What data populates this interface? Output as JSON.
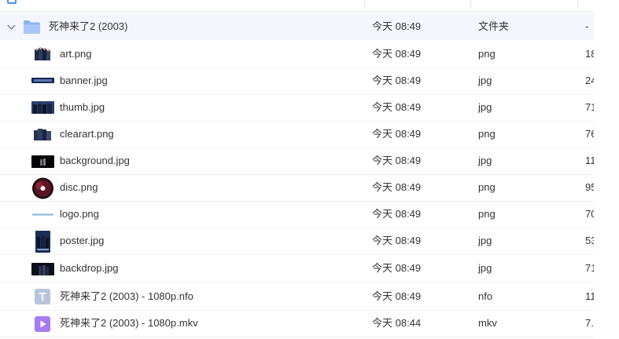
{
  "folder": {
    "name": "死神来了2 (2003)",
    "date": "今天 08:49",
    "type": "文件夹",
    "size": "-"
  },
  "files": [
    {
      "name": "art.png",
      "date": "今天 08:49",
      "type": "png",
      "size": "18",
      "icon": "art-thumbnail-icon"
    },
    {
      "name": "banner.jpg",
      "date": "今天 08:49",
      "type": "jpg",
      "size": "24",
      "icon": "banner-thumbnail-icon"
    },
    {
      "name": "thumb.jpg",
      "date": "今天 08:49",
      "type": "jpg",
      "size": "71",
      "icon": "thumb-thumbnail-icon"
    },
    {
      "name": "clearart.png",
      "date": "今天 08:49",
      "type": "png",
      "size": "76",
      "icon": "clearart-thumbnail-icon"
    },
    {
      "name": "background.jpg",
      "date": "今天 08:49",
      "type": "jpg",
      "size": "11",
      "icon": "background-thumbnail-icon"
    },
    {
      "name": "disc.png",
      "date": "今天 08:49",
      "type": "png",
      "size": "95",
      "icon": "disc-thumbnail-icon"
    },
    {
      "name": "logo.png",
      "date": "今天 08:49",
      "type": "png",
      "size": "70",
      "icon": "logo-thumbnail-icon"
    },
    {
      "name": "poster.jpg",
      "date": "今天 08:49",
      "type": "jpg",
      "size": "53",
      "icon": "poster-thumbnail-icon"
    },
    {
      "name": "backdrop.jpg",
      "date": "今天 08:49",
      "type": "jpg",
      "size": "71",
      "icon": "backdrop-thumbnail-icon"
    },
    {
      "name": "死神来了2 (2003) - 1080p.nfo",
      "date": "今天 08:49",
      "type": "nfo",
      "size": "11",
      "icon": "text-file-icon"
    },
    {
      "name": "死神来了2 (2003) - 1080p.mkv",
      "date": "今天 08:44",
      "type": "mkv",
      "size": "7.",
      "icon": "video-file-icon"
    }
  ],
  "colors": {
    "accent": "#4a8cf6",
    "folder": "#8db4f7",
    "video": "#a57cf3",
    "text_file": "#b6c5d9",
    "row_selected": "#f3f6fd"
  }
}
